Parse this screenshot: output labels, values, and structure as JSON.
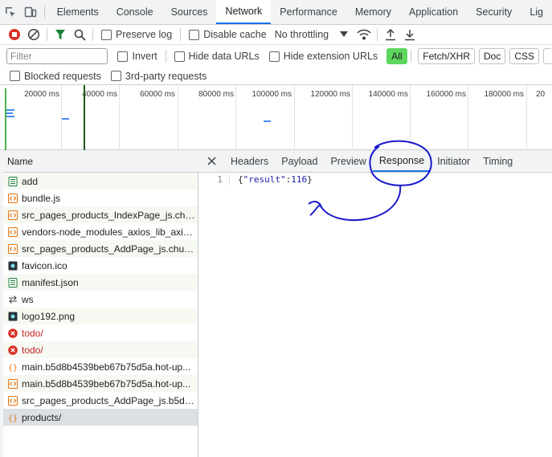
{
  "topbar": {
    "tabs": [
      {
        "label": "Elements",
        "active": false
      },
      {
        "label": "Console",
        "active": false
      },
      {
        "label": "Sources",
        "active": false
      },
      {
        "label": "Network",
        "active": true
      },
      {
        "label": "Performance",
        "active": false
      },
      {
        "label": "Memory",
        "active": false
      },
      {
        "label": "Application",
        "active": false
      },
      {
        "label": "Security",
        "active": false
      },
      {
        "label": "Lig",
        "active": false
      }
    ]
  },
  "toolbar": {
    "preserve_log": "Preserve log",
    "disable_cache": "Disable cache",
    "throttling": "No throttling"
  },
  "filter": {
    "placeholder": "Filter",
    "invert": "Invert",
    "hide_data_urls": "Hide data URLs",
    "hide_extension_urls": "Hide extension URLs",
    "type_pills": [
      "All",
      "Fetch/XHR",
      "Doc",
      "CSS"
    ],
    "blocked_requests": "Blocked requests",
    "third_party": "3rd-party requests"
  },
  "overview": {
    "ticks": [
      "20000 ms",
      "40000 ms",
      "60000 ms",
      "80000 ms",
      "100000 ms",
      "120000 ms",
      "140000 ms",
      "160000 ms",
      "180000 ms",
      "20"
    ]
  },
  "requests": {
    "header": "Name",
    "rows": [
      {
        "name": "add",
        "icon": "document-icon",
        "error": false
      },
      {
        "name": "bundle.js",
        "icon": "script-icon",
        "error": false
      },
      {
        "name": "src_pages_products_IndexPage_js.chun...",
        "icon": "script-icon",
        "error": false
      },
      {
        "name": "vendors-node_modules_axios_lib_axios...",
        "icon": "script-icon",
        "error": false
      },
      {
        "name": "src_pages_products_AddPage_js.chunk.js",
        "icon": "script-icon",
        "error": false
      },
      {
        "name": "favicon.ico",
        "icon": "image-icon",
        "error": false
      },
      {
        "name": "manifest.json",
        "icon": "document-icon",
        "error": false
      },
      {
        "name": "ws",
        "icon": "websocket-icon",
        "error": false
      },
      {
        "name": "logo192.png",
        "icon": "image-icon",
        "error": false
      },
      {
        "name": "todo/",
        "icon": "error-icon",
        "error": true
      },
      {
        "name": "todo/",
        "icon": "error-icon",
        "error": true
      },
      {
        "name": "main.b5d8b4539beb67b75d5a.hot-up...",
        "icon": "fetch-icon",
        "error": false
      },
      {
        "name": "main.b5d8b4539beb67b75d5a.hot-up...",
        "icon": "script-icon",
        "error": false
      },
      {
        "name": "src_pages_products_AddPage_js.b5d8b...",
        "icon": "script-icon",
        "error": false
      },
      {
        "name": "products/",
        "icon": "fetch-icon",
        "error": false,
        "selected": true
      }
    ]
  },
  "detail": {
    "tabs": [
      {
        "label": "Headers",
        "active": false
      },
      {
        "label": "Payload",
        "active": false
      },
      {
        "label": "Preview",
        "active": false
      },
      {
        "label": "Response",
        "active": true
      },
      {
        "label": "Initiator",
        "active": false
      },
      {
        "label": "Timing",
        "active": false
      }
    ],
    "response": {
      "line_number": "1",
      "brace_open": "{",
      "key": "\"result\"",
      "colon": ":",
      "value": "116",
      "brace_close": "}"
    }
  },
  "colors": {
    "accent": "#1a73e8",
    "error": "#c5221f",
    "all_pill": "#5cd65c",
    "annotation": "#1a1acc"
  }
}
